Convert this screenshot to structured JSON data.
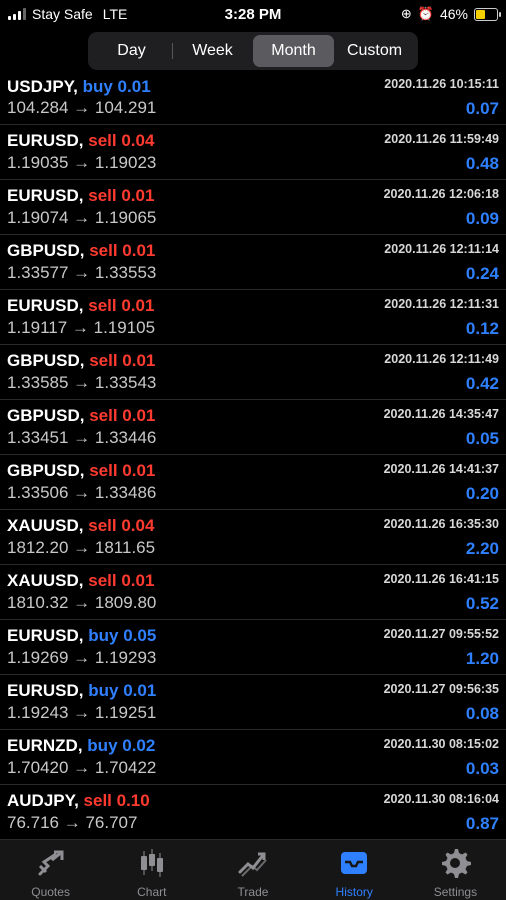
{
  "status": {
    "carrier": "Stay Safe",
    "network": "LTE",
    "time": "3:28 PM",
    "battery": "46%"
  },
  "segments": [
    {
      "label": "Day",
      "active": false
    },
    {
      "label": "Week",
      "active": false
    },
    {
      "label": "Month",
      "active": true
    },
    {
      "label": "Custom",
      "active": false
    }
  ],
  "deals": [
    {
      "symbol": "USDJPY,",
      "side": "buy",
      "lot": "buy 0.01",
      "prices": "104.284 → 104.291",
      "time": "2020.11.26 10:15:11",
      "profit": "0.07"
    },
    {
      "symbol": "EURUSD,",
      "side": "sell",
      "lot": "sell 0.04",
      "prices": "1.19035 → 1.19023",
      "time": "2020.11.26 11:59:49",
      "profit": "0.48"
    },
    {
      "symbol": "EURUSD,",
      "side": "sell",
      "lot": "sell 0.01",
      "prices": "1.19074 → 1.19065",
      "time": "2020.11.26 12:06:18",
      "profit": "0.09"
    },
    {
      "symbol": "GBPUSD,",
      "side": "sell",
      "lot": "sell 0.01",
      "prices": "1.33577 → 1.33553",
      "time": "2020.11.26 12:11:14",
      "profit": "0.24"
    },
    {
      "symbol": "EURUSD,",
      "side": "sell",
      "lot": "sell 0.01",
      "prices": "1.19117 → 1.19105",
      "time": "2020.11.26 12:11:31",
      "profit": "0.12"
    },
    {
      "symbol": "GBPUSD,",
      "side": "sell",
      "lot": "sell 0.01",
      "prices": "1.33585 → 1.33543",
      "time": "2020.11.26 12:11:49",
      "profit": "0.42"
    },
    {
      "symbol": "GBPUSD,",
      "side": "sell",
      "lot": "sell 0.01",
      "prices": "1.33451 → 1.33446",
      "time": "2020.11.26 14:35:47",
      "profit": "0.05"
    },
    {
      "symbol": "GBPUSD,",
      "side": "sell",
      "lot": "sell 0.01",
      "prices": "1.33506 → 1.33486",
      "time": "2020.11.26 14:41:37",
      "profit": "0.20"
    },
    {
      "symbol": "XAUUSD,",
      "side": "sell",
      "lot": "sell 0.04",
      "prices": "1812.20 → 1811.65",
      "time": "2020.11.26 16:35:30",
      "profit": "2.20"
    },
    {
      "symbol": "XAUUSD,",
      "side": "sell",
      "lot": "sell 0.01",
      "prices": "1810.32 → 1809.80",
      "time": "2020.11.26 16:41:15",
      "profit": "0.52"
    },
    {
      "symbol": "EURUSD,",
      "side": "buy",
      "lot": "buy 0.05",
      "prices": "1.19269 → 1.19293",
      "time": "2020.11.27 09:55:52",
      "profit": "1.20"
    },
    {
      "symbol": "EURUSD,",
      "side": "buy",
      "lot": "buy 0.01",
      "prices": "1.19243 → 1.19251",
      "time": "2020.11.27 09:56:35",
      "profit": "0.08"
    },
    {
      "symbol": "EURNZD,",
      "side": "buy",
      "lot": "buy 0.02",
      "prices": "1.70420 → 1.70422",
      "time": "2020.11.30 08:15:02",
      "profit": "0.03"
    },
    {
      "symbol": "AUDJPY,",
      "side": "sell",
      "lot": "sell 0.10",
      "prices": "76.716 → 76.707",
      "time": "2020.11.30 08:16:04",
      "profit": "0.87"
    }
  ],
  "tabs": [
    {
      "label": "Quotes",
      "icon": "quotes-icon",
      "active": false
    },
    {
      "label": "Chart",
      "icon": "candlestick-icon",
      "active": false
    },
    {
      "label": "Trade",
      "icon": "trade-icon",
      "active": false
    },
    {
      "label": "History",
      "icon": "inbox-icon",
      "active": true
    },
    {
      "label": "Settings",
      "icon": "gear-icon",
      "active": false
    }
  ],
  "colors": {
    "buy": "#2f80ff",
    "sell": "#ff3b30",
    "accent": "#2f80ff",
    "battery": "#f5d000"
  }
}
